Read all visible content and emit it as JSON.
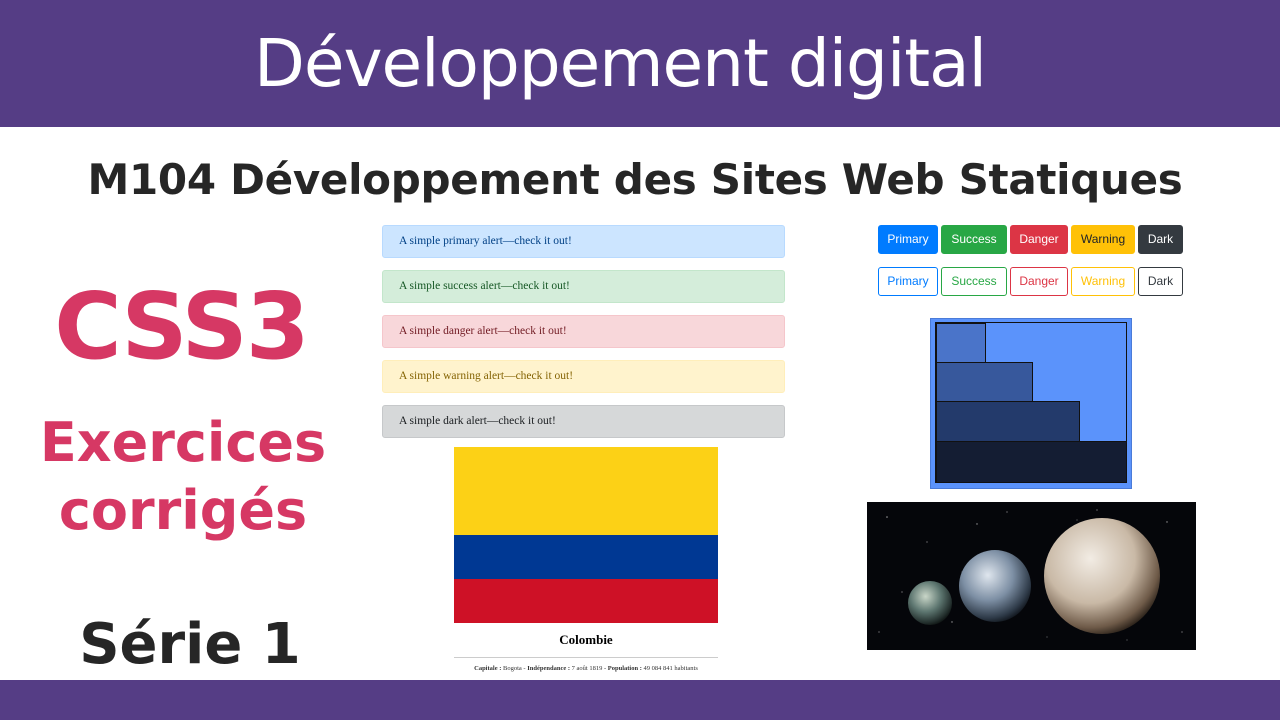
{
  "header": {
    "title": "Développement digital"
  },
  "subtitle": "M104 Développement des Sites Web Statiques",
  "left": {
    "css3": "CSS3",
    "exercices": "Exercices",
    "corriges": "corrigés",
    "serie": "Série 1"
  },
  "alerts": [
    {
      "text": "A simple primary alert—check it out!"
    },
    {
      "text": "A simple success alert—check it out!"
    },
    {
      "text": "A simple danger alert—check it out!"
    },
    {
      "text": "A simple warning alert—check it out!"
    },
    {
      "text": "A simple dark alert—check it out!"
    }
  ],
  "buttons": {
    "solid": [
      "Primary",
      "Success",
      "Danger",
      "Warning",
      "Dark"
    ],
    "outline": [
      "Primary",
      "Success",
      "Danger",
      "Warning",
      "Dark"
    ]
  },
  "flag": {
    "title": "Colombie",
    "capitale_label": "Capitale :",
    "capitale_value": "Bogota -",
    "independance_label": "Indépendance :",
    "independance_value": "7 août 1819 -",
    "population_label": "Population :",
    "population_value": "49 084 841 habitants",
    "colors": {
      "yellow": "#fcd116",
      "blue": "#003893",
      "red": "#ce1126"
    }
  },
  "colors": {
    "bar": "#553d85",
    "accent": "#d63864",
    "dark_text": "#262626",
    "stairs_bg": "#5b93fb"
  },
  "icons": {
    "planets_image": "planets-image",
    "staircase_image": "staircase-image"
  }
}
